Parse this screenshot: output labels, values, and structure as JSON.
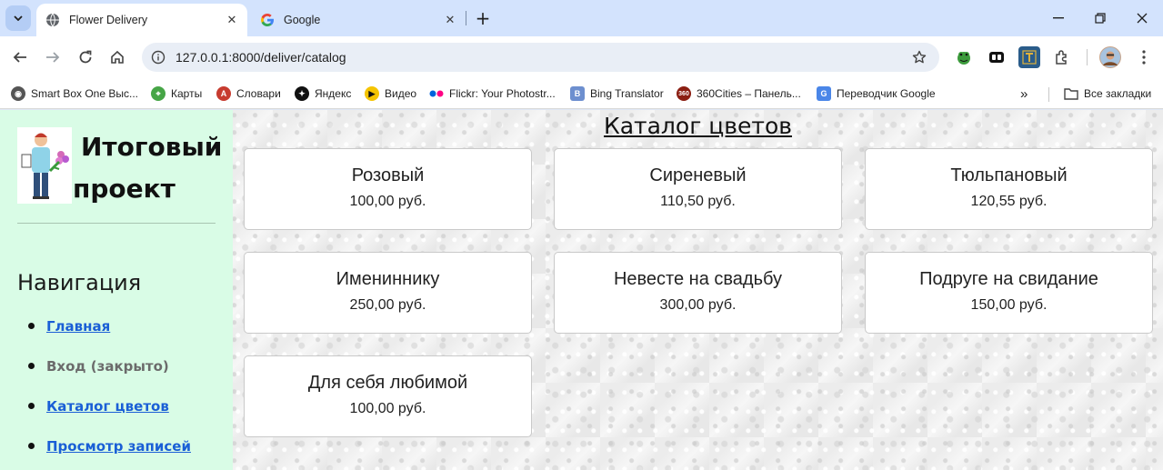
{
  "browser": {
    "tabs": [
      {
        "title": "Flower Delivery",
        "active": true
      },
      {
        "title": "Google",
        "active": false
      }
    ],
    "url": "127.0.0.1:8000/deliver/catalog",
    "bookmarks": [
      "Smart Box One Выс...",
      "Карты",
      "Словари",
      "Яндекс",
      "Видео",
      "Flickr: Your Photostr...",
      "Bing Translator",
      "360Cities – Панель...",
      "Переводчик Google"
    ],
    "all_bookmarks": "Все закладки"
  },
  "sidebar": {
    "title_line1": "Итоговый",
    "title_line2": "проект",
    "nav_title": "Навигация",
    "nav_items": [
      {
        "label": "Главная",
        "link": true
      },
      {
        "label": "Вход (закрыто)",
        "link": false
      },
      {
        "label": "Каталог цветов",
        "link": true
      },
      {
        "label": "Просмотр записей",
        "link": true
      }
    ]
  },
  "catalog": {
    "title": "Каталог цветов",
    "items": [
      {
        "name": "Розовый",
        "price": "100,00 руб."
      },
      {
        "name": "Сиреневый",
        "price": "110,50 руб."
      },
      {
        "name": "Тюльпановый",
        "price": "120,55 руб."
      },
      {
        "name": "Имениннику",
        "price": "250,00 руб."
      },
      {
        "name": "Невесте на свадьбу",
        "price": "300,00 руб."
      },
      {
        "name": "Подруге на свидание",
        "price": "150,00 руб."
      },
      {
        "name": "Для себя любимой",
        "price": "100,00 руб."
      }
    ]
  }
}
